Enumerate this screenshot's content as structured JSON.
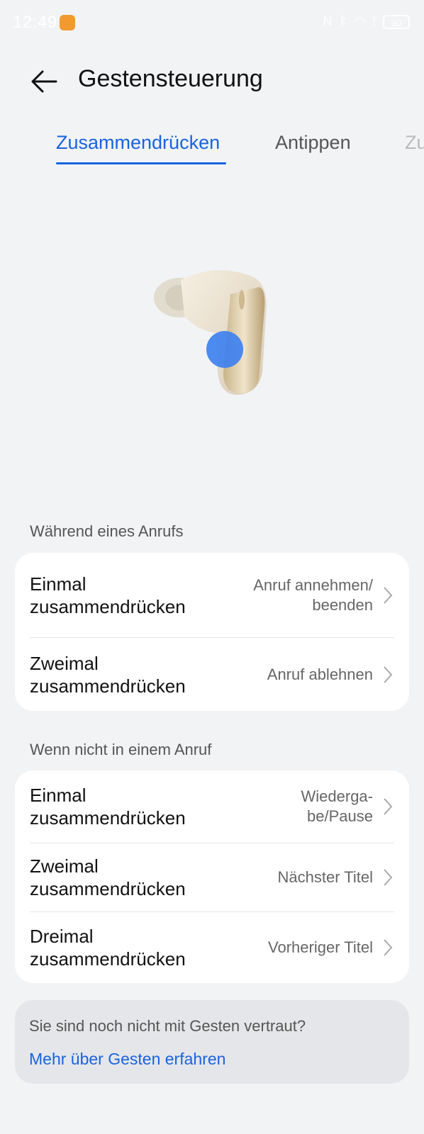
{
  "status": {
    "time": "12:49",
    "battery": "90"
  },
  "header": {
    "title": "Gestensteuerung"
  },
  "tabs": [
    {
      "label": "Zusammendrücken",
      "active": true
    },
    {
      "label": "Antippen",
      "active": false
    },
    {
      "label": "Zu",
      "active": false
    }
  ],
  "sections": [
    {
      "title": "Während eines Anrufs",
      "rows": [
        {
          "label": "Einmal zusammendrücken",
          "value": "Anruf annehmen/ beenden"
        },
        {
          "label": "Zweimal zusammendrücken",
          "value": "Anruf ablehnen"
        }
      ]
    },
    {
      "title": "Wenn nicht in einem Anruf",
      "rows": [
        {
          "label": "Einmal zusammendrücken",
          "value": "Wiederga- be/Pause"
        },
        {
          "label": "Zweimal zusammendrücken",
          "value": "Nächster Titel"
        },
        {
          "label": "Dreimal zusammendrücken",
          "value": "Vorheriger Titel"
        }
      ]
    }
  ],
  "info": {
    "text": "Sie sind noch nicht mit Gesten vertraut?",
    "link": "Mehr über Gesten erfahren"
  },
  "colors": {
    "accent": "#1a63e0",
    "background": "#f1f3f5",
    "card": "#ffffff"
  }
}
